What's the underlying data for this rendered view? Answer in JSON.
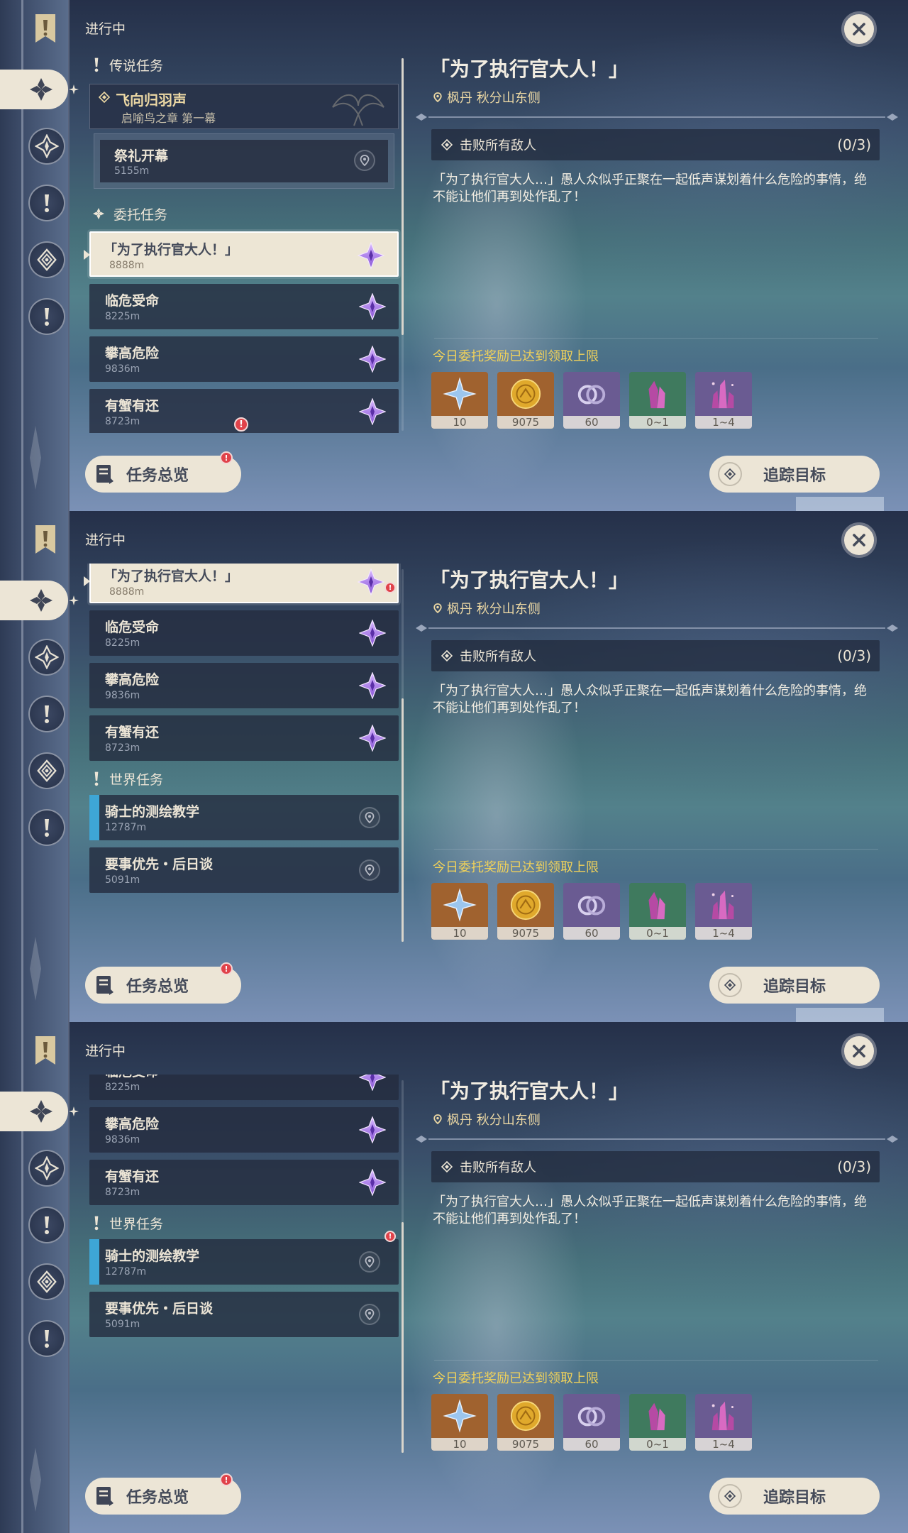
{
  "header": {
    "status_label": "进行中"
  },
  "sections": {
    "legend": "传说任务",
    "commission": "委托任务",
    "world": "世界任务"
  },
  "legend_quest": {
    "title": "飞向归羽声",
    "chapter": "启喻鸟之章 第一幕"
  },
  "legend_sub": {
    "title": "祭礼开幕",
    "distance": "5155m"
  },
  "commissions": [
    {
      "title": "「为了执行官大人！」",
      "distance": "8888m"
    },
    {
      "title": "临危受命",
      "distance": "8225m"
    },
    {
      "title": "攀高危险",
      "distance": "9836m"
    },
    {
      "title": "有蟹有还",
      "distance": "8723m"
    }
  ],
  "world_quests": [
    {
      "title": "骑士的测绘教学",
      "distance": "12787m"
    },
    {
      "title": "要事优先・后日谈",
      "distance": "5091m"
    }
  ],
  "alert_mark": "!",
  "detail": {
    "title": "「为了执行官大人！」",
    "location": "枫丹 秋分山东侧",
    "objective": "击败所有敌人",
    "objective_count": "(0/3)",
    "description": "「为了执行官大人…」愚人众似乎正聚在一起低声谋划着什么危险的事情，绝不能让他们再到处作乱了！",
    "reward_heading": "今日委托奖励已达到领取上限",
    "rewards": [
      {
        "name": "adventure-exp",
        "qty": "10",
        "color": "#a0622f"
      },
      {
        "name": "mora",
        "qty": "9075",
        "color": "#a0622f"
      },
      {
        "name": "friendship-exp",
        "qty": "60",
        "color": "#6a5b92"
      },
      {
        "name": "crystal-chunk",
        "qty": "0~1",
        "color": "#3f7a5e"
      },
      {
        "name": "crystal-cluster",
        "qty": "1~4",
        "color": "#6a5b92"
      }
    ]
  },
  "buttons": {
    "overview": "任务总览",
    "track": "追踪目标"
  },
  "colors": {
    "accent_gold": "#ecd8a4",
    "reward_yellow": "#f0d15a",
    "cream": "#ece5d6",
    "world_blue": "#3ea6d6",
    "alert_red": "#e0424a"
  }
}
